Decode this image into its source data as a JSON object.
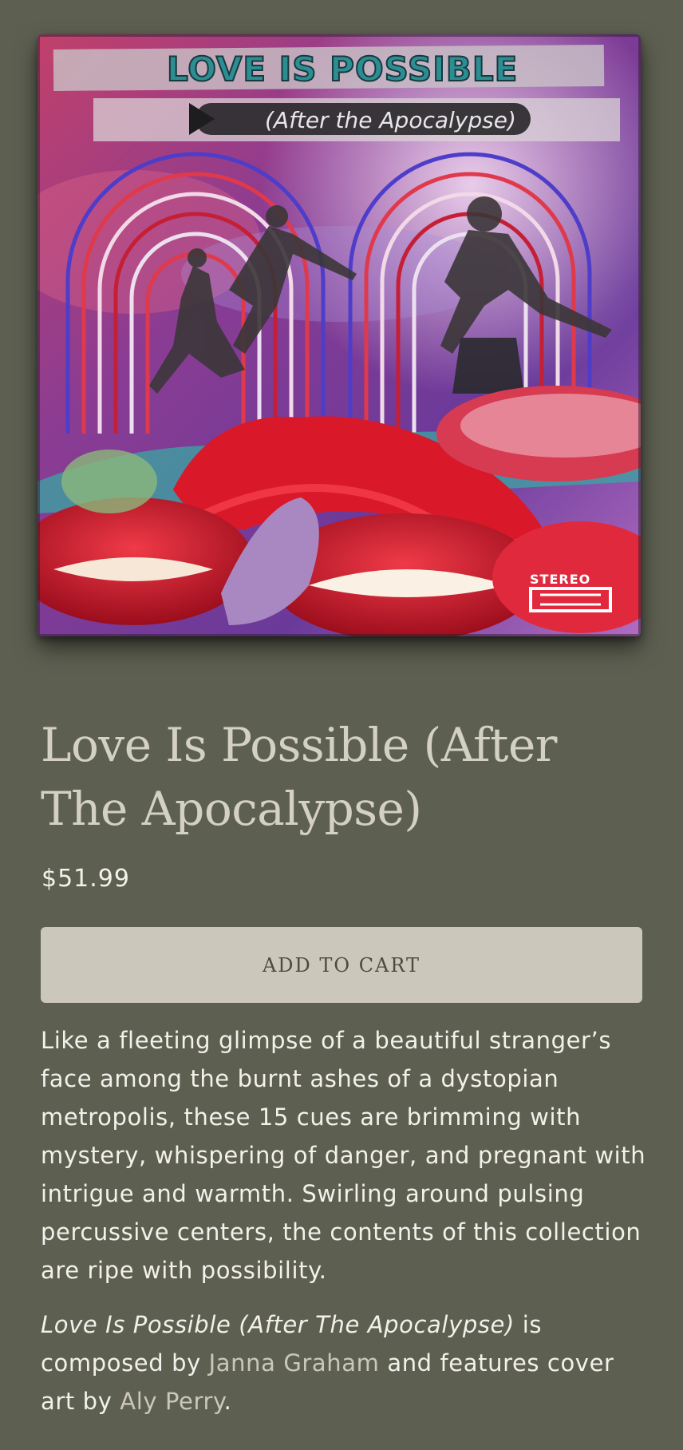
{
  "product": {
    "title": "Love Is Possible (After The Apocalypse)",
    "price": "$51.99",
    "add_to_cart_label": "ADD TO CART",
    "cover_art": {
      "title_text": "LOVE IS POSSIBLE",
      "subtitle_text": "(After the Apocalypse)",
      "stereo_text": "STEREO",
      "colors": {
        "background_purple": "#7a3d8f",
        "lips_red": "#d4182c",
        "arch_blue": "#4d3dc9",
        "arch_red": "#e0394b"
      }
    },
    "description": {
      "paragraph1": "Like a fleeting glimpse of a beautiful stranger’s face among the burnt ashes of a dystopian metropolis, these 15 cues are brimming with mystery, whispering of danger, and pregnant with intrigue and warmth. Swirling around pulsing percussive centers, the contents of this collection are ripe with possibility.",
      "paragraph2": {
        "title_italic": "Love Is Possible (After The Apocalypse)",
        "text_is": " is composed by ",
        "composer": "Janna Graham",
        "text_features": " and features cover art by ",
        "artist": "Aly Perry",
        "text_end": "."
      }
    }
  },
  "colors": {
    "page_background": "#5d6051",
    "title_color": "#d4d1c3",
    "button_background": "#cbc7ba",
    "link_color": "#cbc7ba"
  }
}
